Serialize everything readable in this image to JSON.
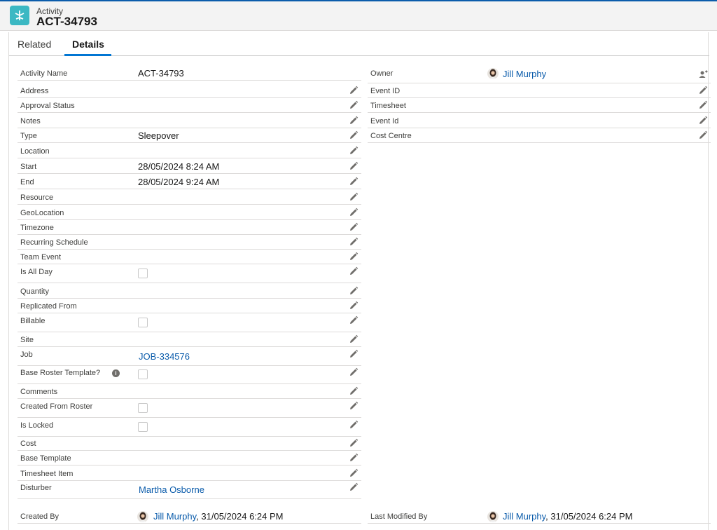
{
  "header": {
    "object_label": "Activity",
    "record_title": "ACT-34793"
  },
  "tabs": [
    {
      "label": "Related"
    },
    {
      "label": "Details"
    }
  ],
  "left_fields": {
    "activity_name": {
      "label": "Activity Name",
      "value": "ACT-34793"
    },
    "address": {
      "label": "Address"
    },
    "approval_status": {
      "label": "Approval Status"
    },
    "notes": {
      "label": "Notes"
    },
    "type": {
      "label": "Type",
      "value": "Sleepover"
    },
    "location": {
      "label": "Location"
    },
    "start": {
      "label": "Start",
      "value": "28/05/2024 8:24 AM"
    },
    "end": {
      "label": "End",
      "value": "28/05/2024 9:24 AM"
    },
    "resource": {
      "label": "Resource"
    },
    "geolocation": {
      "label": "GeoLocation"
    },
    "timezone": {
      "label": "Timezone"
    },
    "recurring_schedule": {
      "label": "Recurring Schedule"
    },
    "team_event": {
      "label": "Team Event"
    },
    "is_all_day": {
      "label": "Is All Day",
      "checked": false
    },
    "quantity": {
      "label": "Quantity"
    },
    "replicated_from": {
      "label": "Replicated From"
    },
    "billable": {
      "label": "Billable",
      "checked": false
    },
    "site": {
      "label": "Site"
    },
    "job": {
      "label": "Job",
      "value": "JOB-334576"
    },
    "base_roster_template": {
      "label": "Base Roster Template?",
      "checked": false
    },
    "comments": {
      "label": "Comments"
    },
    "created_from_roster": {
      "label": "Created From Roster",
      "checked": false
    },
    "is_locked": {
      "label": "Is Locked",
      "checked": false
    },
    "cost": {
      "label": "Cost"
    },
    "base_template": {
      "label": "Base Template"
    },
    "timesheet_item": {
      "label": "Timesheet Item"
    },
    "disturber": {
      "label": "Disturber",
      "value": "Martha Osborne"
    }
  },
  "right_fields": {
    "owner": {
      "label": "Owner",
      "value": "Jill Murphy"
    },
    "event_id": {
      "label": "Event ID"
    },
    "timesheet": {
      "label": "Timesheet"
    },
    "event_id_2": {
      "label": "Event Id"
    },
    "cost_centre": {
      "label": "Cost Centre"
    }
  },
  "footer": {
    "created_by": {
      "label": "Created By",
      "user": "Jill Murphy",
      "date": ", 31/05/2024 6:24 PM"
    },
    "last_modified_by": {
      "label": "Last Modified By",
      "user": "Jill Murphy",
      "date": ", 31/05/2024 6:24 PM"
    }
  },
  "colors": {
    "accent": "#0176d3",
    "link": "#0b5cab",
    "app_icon": "#3bb8c3",
    "header_bg": "#f3f3f3"
  },
  "icons": {
    "app": "activity-icon",
    "edit": "pencil-icon",
    "change_owner": "change-owner-icon",
    "help": "info-icon"
  }
}
